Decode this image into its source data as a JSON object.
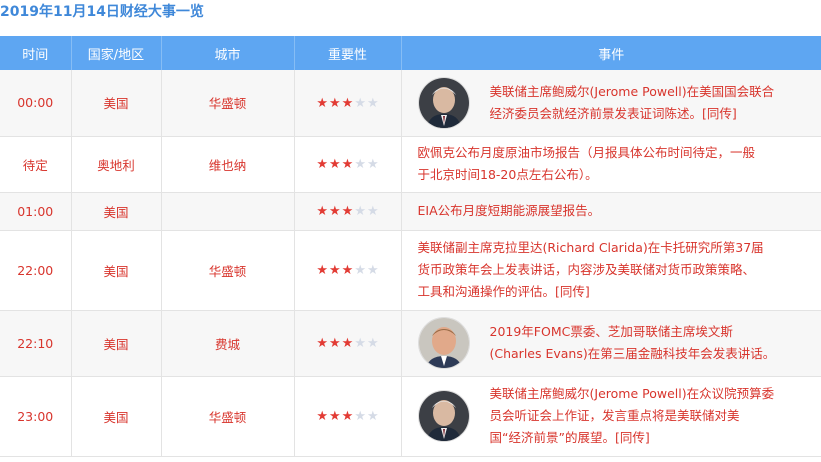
{
  "title": "2019年11月14日财经大事一览",
  "colors": {
    "header": "#5ea6f2",
    "text_red": "#d8352d",
    "title_blue": "#3f88d9",
    "star_on": "#e23b34",
    "star_off": "#d5dbe6"
  },
  "columns": [
    "时间",
    "国家/地区",
    "城市",
    "重要性",
    "事件"
  ],
  "rows": [
    {
      "time": "00:00",
      "country": "美国",
      "city": "华盛顿",
      "stars": 3,
      "stars_max": 5,
      "avatar": "powell-portrait",
      "lines": [
        "美联储主席鲍威尔(Jerome Powell)在美国国会联合",
        "经济委员会就经济前景发表证词陈述。[同传]"
      ]
    },
    {
      "time": "待定",
      "country": "奥地利",
      "city": "维也纳",
      "stars": 3,
      "stars_max": 5,
      "avatar": "",
      "lines": [
        "欧佩克公布月度原油市场报告（月报具体公布时间待定，一般",
        "于北京时间18-20点左右公布）。"
      ]
    },
    {
      "time": "01:00",
      "country": "美国",
      "city": "",
      "stars": 3,
      "stars_max": 5,
      "avatar": "",
      "lines": [
        "EIA公布月度短期能源展望报告。"
      ]
    },
    {
      "time": "22:00",
      "country": "美国",
      "city": "华盛顿",
      "stars": 3,
      "stars_max": 5,
      "avatar": "",
      "lines": [
        "美联储副主席克拉里达(Richard Clarida)在卡托研究所第37届",
        "货币政策年会上发表讲话，内容涉及美联储对货币政策策略、",
        "工具和沟通操作的评估。[同传]"
      ]
    },
    {
      "time": "22:10",
      "country": "美国",
      "city": "费城",
      "stars": 3,
      "stars_max": 5,
      "avatar": "evans-portrait",
      "lines": [
        "2019年FOMC票委、芝加哥联储主席埃文斯",
        "(Charles Evans)在第三届金融科技年会发表讲话。"
      ]
    },
    {
      "time": "23:00",
      "country": "美国",
      "city": "华盛顿",
      "stars": 3,
      "stars_max": 5,
      "avatar": "powell-portrait",
      "lines": [
        "美联储主席鲍威尔(Jerome Powell)在众议院预算委",
        "员会听证会上作证，发言重点将是美联储对美",
        "国“经济前景”的展望。[同传]"
      ]
    }
  ]
}
